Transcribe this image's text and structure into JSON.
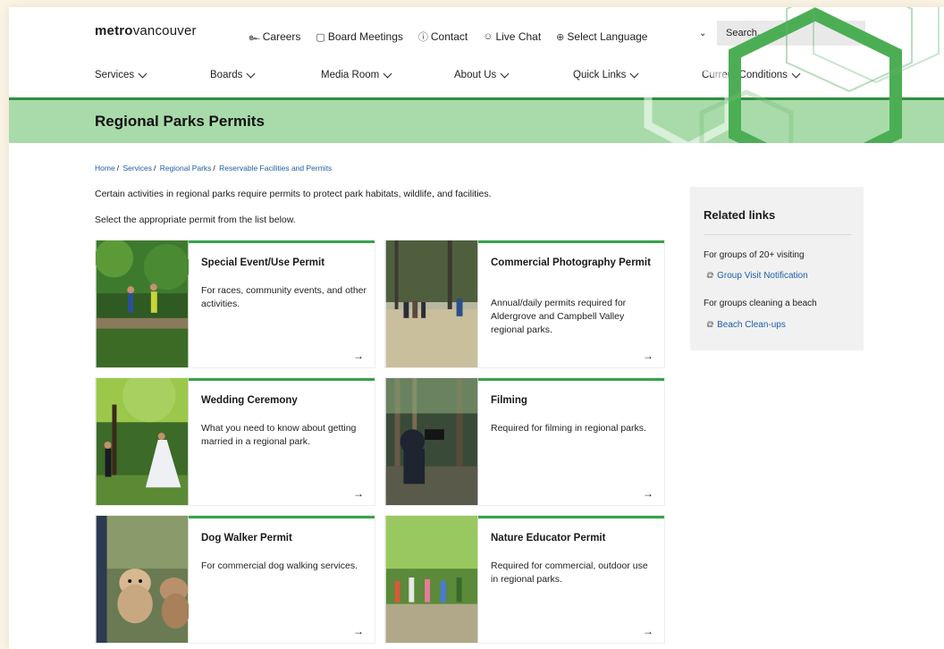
{
  "header": {
    "logo_bold": "metro",
    "logo_rest": "vancouver",
    "utility": [
      {
        "icon": "people-icon",
        "glyph": "๛",
        "label": "Careers"
      },
      {
        "icon": "calendar-icon",
        "glyph": "▢",
        "label": "Board Meetings"
      },
      {
        "icon": "info-icon",
        "glyph": "ⓘ",
        "label": "Contact"
      },
      {
        "icon": "chat-icon",
        "glyph": "☺",
        "label": "Live Chat"
      },
      {
        "icon": "globe-icon",
        "glyph": "⊕",
        "label": "Select Language"
      }
    ],
    "search_placeholder": "Search..."
  },
  "nav": [
    {
      "label": "Services"
    },
    {
      "label": "Boards"
    },
    {
      "label": "Media Room"
    },
    {
      "label": "About Us"
    },
    {
      "label": "Quick Links"
    },
    {
      "label": "Current Conditions"
    }
  ],
  "page_title": "Regional Parks Permits",
  "breadcrumb": [
    "Home",
    "Services",
    "Regional Parks",
    "Reservable Facilities and Permits"
  ],
  "intro": "Certain activities in regional parks require permits to protect park habitats, wildlife, and facilities.",
  "intro2": "Select the appropriate permit from the list below.",
  "cards": [
    {
      "title": "Special Event/Use Permit",
      "desc": "For races, community events, and other activities.",
      "arrow": "→"
    },
    {
      "title": "Commercial Photography Permit",
      "desc": "Annual/daily permits required for Aldergrove and Campbell Valley regional parks.",
      "arrow": "→"
    },
    {
      "title": "Wedding Ceremony",
      "desc": "What you need to know about getting married in a regional park.",
      "arrow": "→"
    },
    {
      "title": "Filming",
      "desc": "Required for filming in regional parks.",
      "arrow": "→"
    },
    {
      "title": "Dog Walker Permit",
      "desc": "For commercial dog walking services.",
      "arrow": "→"
    },
    {
      "title": "Nature Educator Permit",
      "desc": "Required for commercial, outdoor use in regional parks.",
      "arrow": "→"
    }
  ],
  "related": {
    "heading": "Related links",
    "items": [
      {
        "text": "For groups of 20+ visiting",
        "link": "Group Visit Notification"
      },
      {
        "text": "For groups cleaning a beach",
        "link": "Beach Clean-ups"
      }
    ]
  },
  "colors": {
    "accent_green": "#3aa14a",
    "banner_green": "#a8dba9",
    "link_blue": "#1f5fa8",
    "backdrop": "#fbf3e3"
  }
}
